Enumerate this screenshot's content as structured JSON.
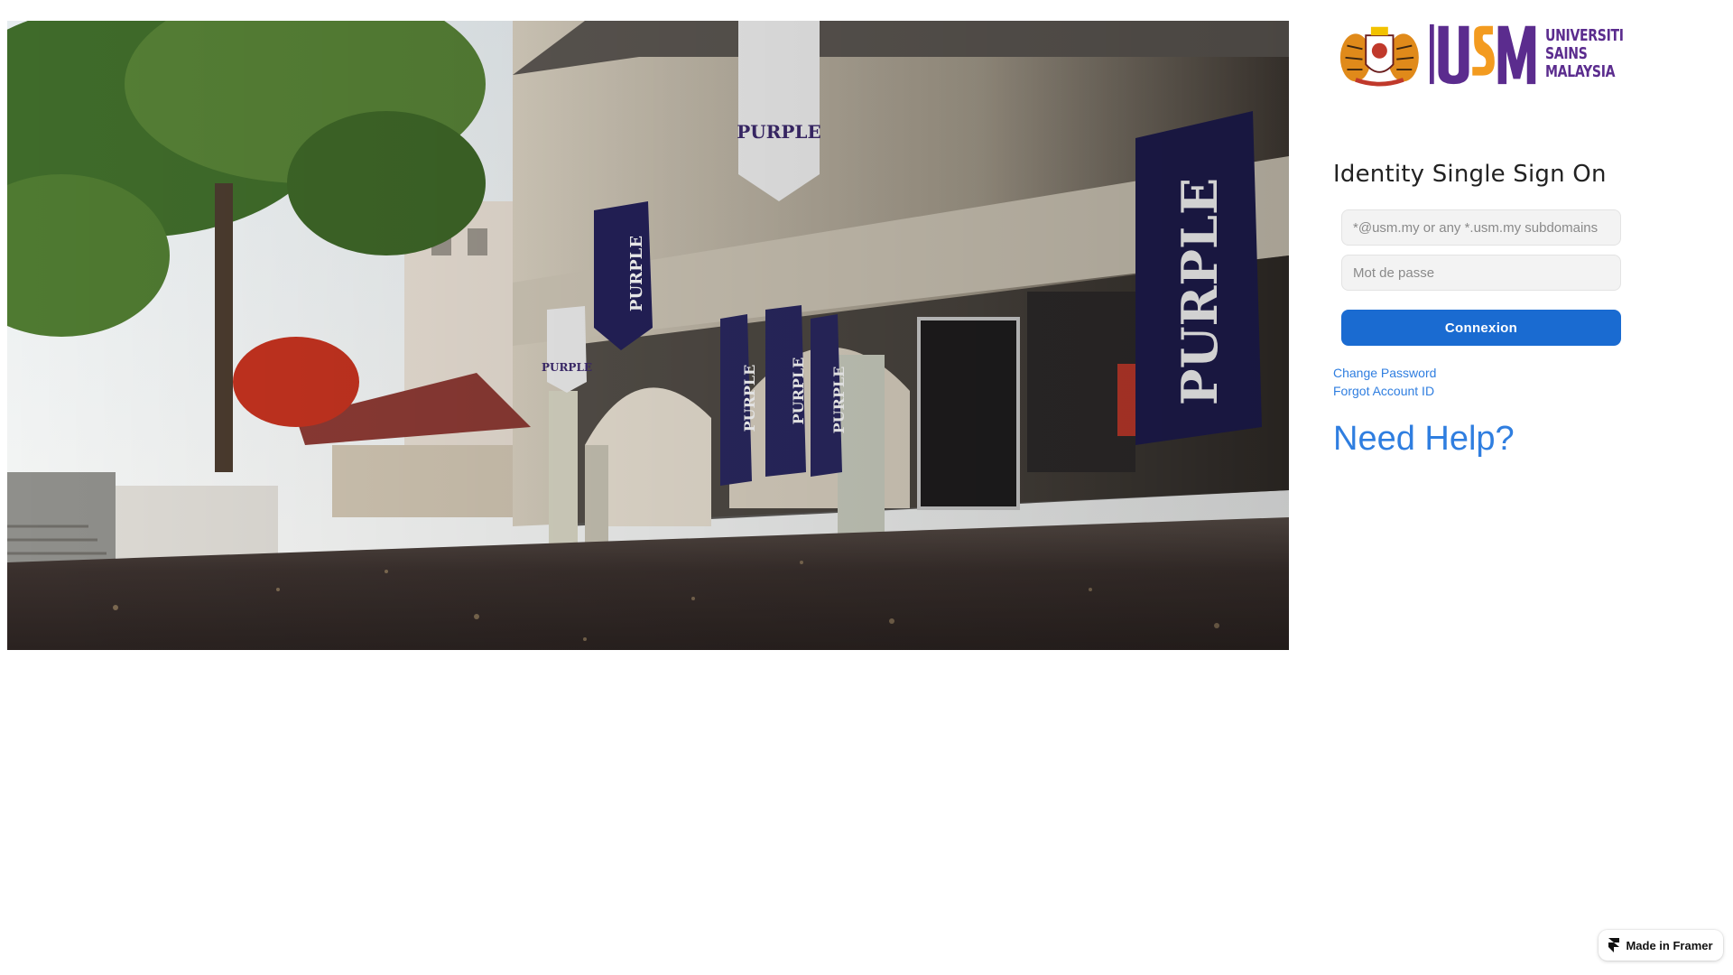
{
  "branding": {
    "logo_lines": [
      "UNIVERSITI",
      "SAINS",
      "MALAYSIA"
    ],
    "logo_mark": "USM",
    "crest_icon": "usm-crest-icon",
    "colors": {
      "usm_purple": "#5b2c8e",
      "usm_orange": "#f39b1f"
    }
  },
  "hero_photo": {
    "banner_texts": [
      "PURPLE",
      "PURPLE",
      "PURPLE",
      "PURPLE",
      "PURPLE",
      "PURPLE",
      "PURPLE"
    ]
  },
  "login": {
    "title": "Identity Single Sign On",
    "username_placeholder": "*@usm.my or any *.usm.my subdomains",
    "password_placeholder": "Mot de passe",
    "submit_label": "Connexion",
    "accent_color": "#1a6bd1"
  },
  "links": {
    "change_password": "Change Password",
    "forgot_account": "Forgot Account ID",
    "need_help": "Need Help?",
    "link_color": "#2f7ee0"
  },
  "badge": {
    "label": "Made in Framer",
    "icon": "framer-icon"
  }
}
